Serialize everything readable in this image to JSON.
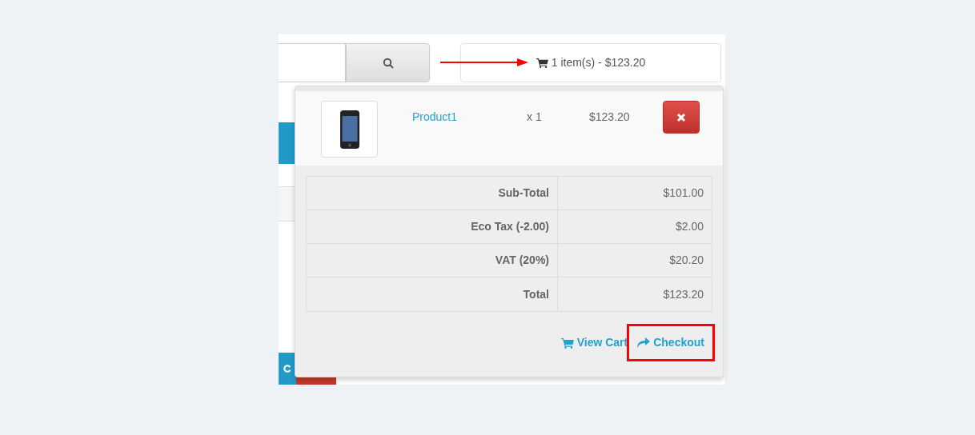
{
  "cart_button": {
    "label": "1 item(s) - $123.20"
  },
  "cart_items": [
    {
      "name": "Product1",
      "quantity": "x 1",
      "price": "$123.20"
    }
  ],
  "totals": [
    {
      "label": "Sub-Total",
      "value": "$101.00"
    },
    {
      "label": "Eco Tax (-2.00)",
      "value": "$2.00"
    },
    {
      "label": "VAT (20%)",
      "value": "$20.20"
    },
    {
      "label": "Total",
      "value": "$123.20"
    }
  ],
  "actions": [
    {
      "kind": "view_cart",
      "label": "View Cart",
      "highlighted": false
    },
    {
      "kind": "checkout",
      "label": "Checkout",
      "highlighted": true
    }
  ]
}
